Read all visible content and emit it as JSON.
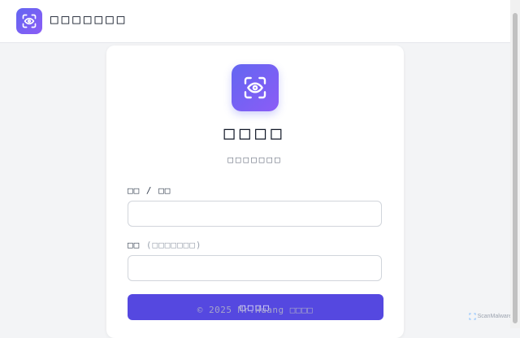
{
  "header": {
    "app_title": "□□□□□□□",
    "logo_icon": "eye-scan-icon"
  },
  "card": {
    "logo_icon": "eye-scan-icon",
    "title": "□□□□",
    "subtitle": "□□□□□□□",
    "username_label": "□□ / □□",
    "password_label": "□□",
    "password_hint": "(□□□□□□□)",
    "username_value": "",
    "password_value": "",
    "submit_label": "□□□□"
  },
  "footer": {
    "copyright": "© 2025 Mr.Huang □□□□"
  },
  "watermark": {
    "text": "ScanMalware"
  },
  "colors": {
    "accent": "#5548e0",
    "logo_gradient_start": "#6366f1",
    "logo_gradient_end": "#8b5cf6"
  }
}
